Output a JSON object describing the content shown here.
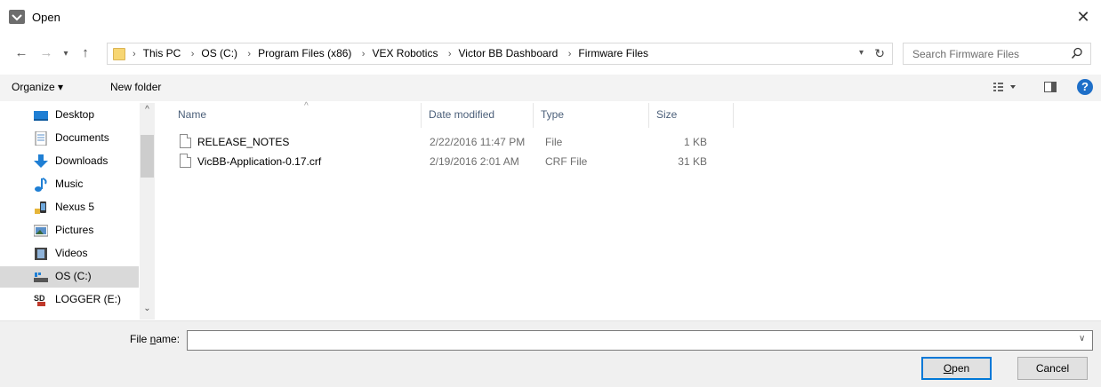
{
  "window": {
    "title": "Open"
  },
  "address": {
    "crumbs": [
      "This PC",
      "OS (C:)",
      "Program Files (x86)",
      "VEX Robotics",
      "Victor BB Dashboard",
      "Firmware Files"
    ]
  },
  "search": {
    "placeholder": "Search Firmware Files"
  },
  "toolbar": {
    "organize_label": "Organize ▾",
    "new_folder_label": "New folder"
  },
  "sidebar": {
    "items": [
      {
        "label": "Desktop",
        "icon": "desktop-icon"
      },
      {
        "label": "Documents",
        "icon": "documents-icon"
      },
      {
        "label": "Downloads",
        "icon": "downloads-icon"
      },
      {
        "label": "Music",
        "icon": "music-icon"
      },
      {
        "label": "Nexus 5",
        "icon": "phone-icon"
      },
      {
        "label": "Pictures",
        "icon": "pictures-icon"
      },
      {
        "label": "Videos",
        "icon": "videos-icon"
      },
      {
        "label": "OS (C:)",
        "icon": "drive-icon",
        "selected": true
      },
      {
        "label": "LOGGER (E:)",
        "icon": "sd-card-icon"
      }
    ]
  },
  "columns": {
    "name": "Name",
    "date": "Date modified",
    "type": "Type",
    "size": "Size"
  },
  "files": [
    {
      "name": "RELEASE_NOTES",
      "date": "2/22/2016 11:47 PM",
      "type": "File",
      "size": "1 KB"
    },
    {
      "name": "VicBB-Application-0.17.crf",
      "date": "2/19/2016 2:01 AM",
      "type": "CRF File",
      "size": "31 KB"
    }
  ],
  "bottom": {
    "file_name_label_pre": "File ",
    "file_name_label_u": "n",
    "file_name_label_post": "ame:",
    "file_name_value": "",
    "open_label_u": "O",
    "open_label_post": "pen",
    "cancel_label": "Cancel"
  },
  "colors": {
    "accent": "#0078d7",
    "folder": "#f7d673",
    "selected_bg": "#d9d9d9",
    "header_text": "#4c607a"
  }
}
